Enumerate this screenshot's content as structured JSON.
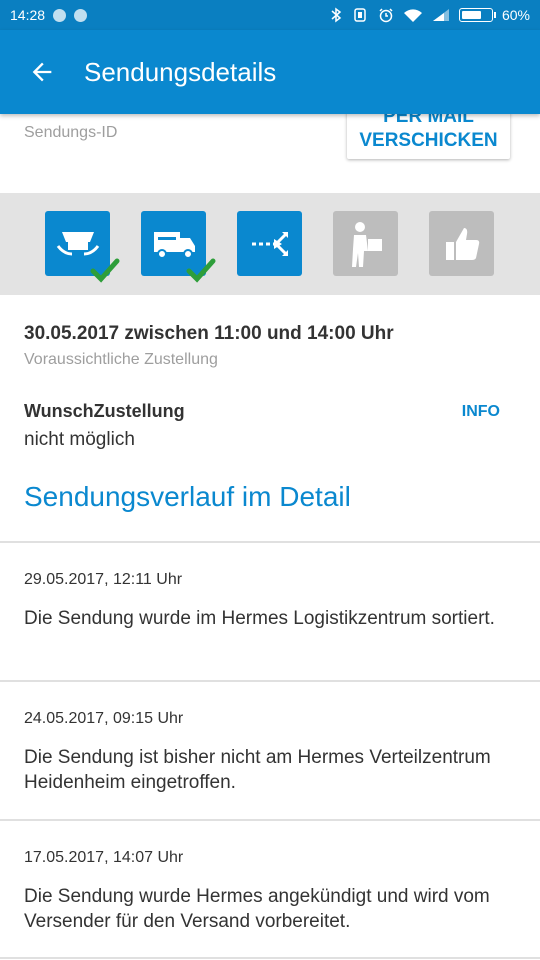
{
  "status_bar": {
    "time": "14:28",
    "battery": "60%"
  },
  "app_bar": {
    "title": "Sendungsdetails",
    "back_icon": "arrow-left-icon"
  },
  "shipment": {
    "id_label": "Sendungs-ID",
    "mail_button": "PER MAIL VERSCHICKEN"
  },
  "progress": {
    "steps": [
      {
        "icon": "parcel-handover-icon",
        "done": true
      },
      {
        "icon": "delivery-truck-icon",
        "done": true
      },
      {
        "icon": "sorting-arrows-icon",
        "done": false,
        "current": true
      },
      {
        "icon": "courier-carrying-parcel-icon",
        "done": false
      },
      {
        "icon": "thumbs-up-icon",
        "done": false
      }
    ]
  },
  "delivery": {
    "date": "30.05.2017 zwischen 11:00 und 14:00 Uhr",
    "subtitle": "Voraussichtliche Zustellung"
  },
  "wish": {
    "title": "WunschZustellung",
    "info": "INFO",
    "value": "nicht möglich"
  },
  "history": {
    "title": "Sendungsverlauf im Detail",
    "events": [
      {
        "date": "29.05.2017, 12:11 Uhr",
        "text": "Die Sendung wurde im Hermes Logistikzentrum sortiert."
      },
      {
        "date": "24.05.2017, 09:15 Uhr",
        "text": "Die Sendung ist bisher nicht am Hermes Verteilzentrum Heidenheim eingetroffen."
      },
      {
        "date": "17.05.2017, 14:07 Uhr",
        "text": "Die Sendung wurde Hermes angekündigt und wird vom Versender für den Versand vorbereitet."
      }
    ]
  },
  "colors": {
    "primary": "#0A88CF",
    "status_bar": "#0A7FC1",
    "check": "#2E9E3A",
    "pending_step": "#BDBDBD"
  }
}
